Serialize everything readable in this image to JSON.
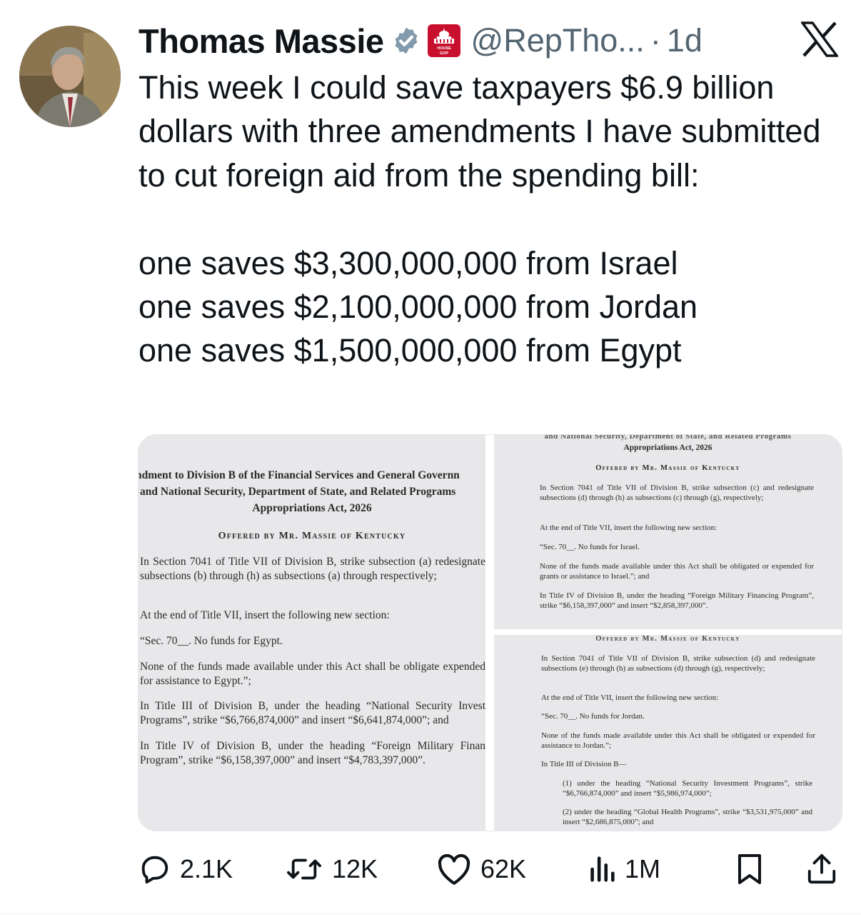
{
  "author": {
    "name": "Thomas Massie",
    "handle": "@RepTho...",
    "separator": "·",
    "time": "1d",
    "verified": true,
    "affiliation_badge_text": "HOUSE GOP",
    "avatar": "profile-photo"
  },
  "tweet": {
    "lines": [
      "This week I could save taxpayers $6.9 billion dollars with three amendments I have submitted to cut foreign aid from the spending bill:",
      "one saves $3,300,000,000 from Israel",
      "one saves $2,100,000,000 from Jordan",
      "one saves $1,500,000,000 from Egypt"
    ]
  },
  "media": {
    "left_doc": {
      "title_lines": [
        "ndment to Division B of the Financial Services and General Governn",
        "and National Security, Department of State, and Related Programs"
      ],
      "act_name": "Appropriations Act, 2026",
      "offered": "Offered by Mr. Massie of Kentucky",
      "paragraphs": [
        "In Section 7041 of Title VII of Division B, strike subsection (a) redesignate subsections (b) through (h) as subsections (a) through respectively;",
        "At the end of Title VII, insert the following new section:",
        "“Sec. 70__. No funds for Egypt.",
        "None of the funds made available under this Act shall be obligate expended for assistance to Egypt.”;",
        "In Title III of Division B, under the heading “National Security Invest Programs”, strike “$6,766,874,000” and insert “$6,641,874,000”; and",
        "In Title IV of Division B, under the heading “Foreign Military Finan Program”, strike “$6,158,397,000” and insert “$4,783,397,000”."
      ]
    },
    "right_top_doc": {
      "cut_header": "and National Security, Department of State, and Related Programs",
      "act_name": "Appropriations Act, 2026",
      "offered": "Offered by Mr. Massie of Kentucky",
      "paragraphs": [
        "In Section 7041 of Title VII of Division B, strike subsection (c) and redesignate subsections (d) through (h) as subsections (c) through (g), respectively;",
        "At the end of Title VII, insert the following new section:",
        "“Sec. 70__. No funds for Israel.",
        "None of the funds made available under this Act shall be obligated or expended for grants or assistance to Israel.”; and",
        "In Title IV of Division B, under the heading “Foreign Military Financing Program”, strike “$6,158,397,000” and insert “$2,858,397,000”."
      ]
    },
    "right_bottom_doc": {
      "offered": "Offered by Mr. Massie of Kentucky",
      "paragraphs": [
        "In Section 7041 of Title VII of Division B, strike subsection (d) and redesignate subsections (e) through (h) as subsections (d) through (g), respectively;",
        "At the end of Title VII, insert the following new section:",
        "“Sec. 70__. No funds for Jordan.",
        "None of the funds made available under this Act shall be obligated or expended for assistance to Jordan.”;",
        "In Title III of Division B—",
        "(1) under the heading “National Security Investment Programs”, strike “$6,766,874,000” and insert “$5,986,974,000”;",
        "(2) under the heading “Global Health Programs”, strike “$3,531,975,000” and insert “$2,686,875,000”; and"
      ]
    }
  },
  "actions": {
    "replies": "2.1K",
    "reposts": "12K",
    "likes": "62K",
    "views": "1M",
    "icons": [
      "reply-icon",
      "repost-icon",
      "like-icon",
      "views-icon",
      "bookmark-icon",
      "share-icon"
    ]
  },
  "colors": {
    "text": "#0f1419",
    "secondary": "#536471",
    "verified": "#829aab",
    "gop_red": "#c8102e",
    "doc_bg": "#e8e8ea"
  }
}
